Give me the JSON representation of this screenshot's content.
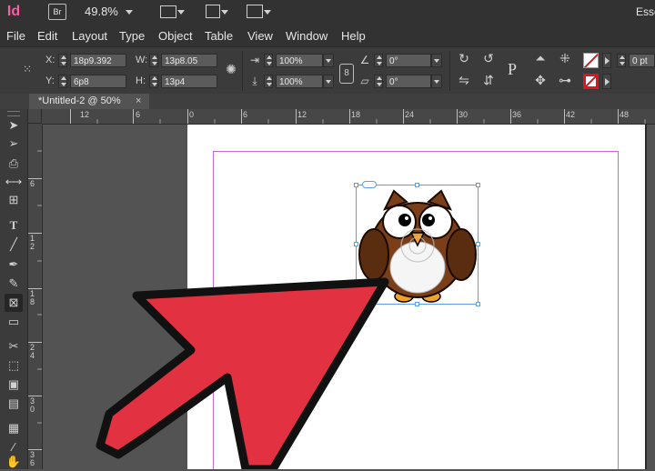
{
  "app": {
    "logo": "Id",
    "bridge_badge": "Br",
    "zoom": "49.8%",
    "workspace": "Esse"
  },
  "menu": [
    "File",
    "Edit",
    "Layout",
    "Type",
    "Object",
    "Table",
    "View",
    "Window",
    "Help"
  ],
  "control": {
    "x_label": "X:",
    "x_value": "18p9.392",
    "y_label": "Y:",
    "y_value": "6p8",
    "w_label": "W:",
    "w_value": "13p8.05",
    "h_label": "H:",
    "h_value": "13p4",
    "scale_x": "100%",
    "scale_y": "100%",
    "rotate": "0°",
    "shear": "0°",
    "stroke_pt": "0 pt"
  },
  "document_tab": {
    "title": "*Untitled-2 @ 50%",
    "close": "×"
  },
  "h_ruler_labels": [
    "12",
    "6",
    "0",
    "6",
    "12",
    "18",
    "24",
    "30",
    "36",
    "42",
    "48"
  ],
  "v_ruler_labels": [
    "6",
    "1 2",
    "1 8",
    "2 4",
    "3 0",
    "3 6"
  ],
  "colors": {
    "accent_logo": "#ff5aa5",
    "arrow": "#e23242",
    "margin_guide": "#c86ad3",
    "selection": "#5aa0e6"
  },
  "icons": [
    "selection-tool-icon",
    "direct-selection-tool-icon",
    "page-tool-icon",
    "gap-tool-icon",
    "content-collector-icon",
    "type-tool-icon",
    "line-tool-icon",
    "pen-tool-icon",
    "pencil-tool-icon",
    "rectangle-frame-tool-icon",
    "rectangle-tool-icon",
    "scissors-tool-icon",
    "free-transform-tool-icon",
    "gradient-swatch-tool-icon",
    "gradient-feather-tool-icon",
    "note-tool-icon",
    "eyedropper-tool-icon",
    "hand-tool-icon"
  ]
}
